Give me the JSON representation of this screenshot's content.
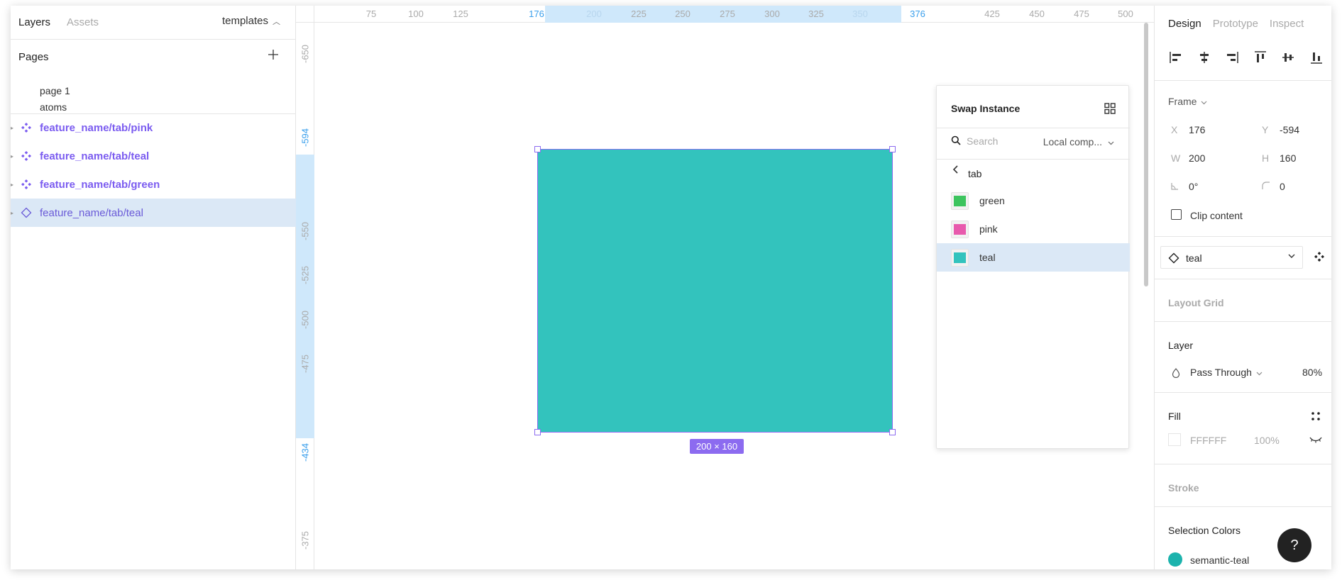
{
  "left_panel": {
    "tabs": [
      {
        "label": "Layers"
      },
      {
        "label": "Assets"
      }
    ],
    "library": "templates",
    "pages_title": "Pages",
    "pages": [
      "page 1",
      "atoms"
    ],
    "layers": [
      {
        "label": "feature_name/tab/pink",
        "kind": "component"
      },
      {
        "label": "feature_name/tab/teal",
        "kind": "component"
      },
      {
        "label": "feature_name/tab/green",
        "kind": "component"
      },
      {
        "label": "feature_name/tab/teal",
        "kind": "instance",
        "selected": true
      }
    ]
  },
  "canvas": {
    "ruler_top": [
      "75",
      "100",
      "125",
      "176",
      "200",
      "225",
      "250",
      "275",
      "300",
      "325",
      "350",
      "376",
      "425",
      "450",
      "475",
      "500"
    ],
    "ruler_left": [
      "-650",
      "-594",
      "-550",
      "-525",
      "-500",
      "-475",
      "-434",
      "-375"
    ],
    "selection_size": "200 × 160",
    "shape_color": "#33c3bd",
    "selection_color": "#8c6bf0"
  },
  "swap_instance": {
    "title": "Swap Instance",
    "search_placeholder": "Search",
    "library": "Local comp...",
    "breadcrumb": "tab",
    "items": [
      {
        "label": "green",
        "color": "#3cc45e"
      },
      {
        "label": "pink",
        "color": "#e85aad"
      },
      {
        "label": "teal",
        "color": "#33c3bd",
        "selected": true
      }
    ]
  },
  "right_panel": {
    "tabs": [
      {
        "label": "Design"
      },
      {
        "label": "Prototype"
      },
      {
        "label": "Inspect"
      }
    ],
    "frame_label": "Frame",
    "x_label": "X",
    "x": "176",
    "y_label": "Y",
    "y": "-594",
    "w_label": "W",
    "w": "200",
    "h_label": "H",
    "h": "160",
    "rotation": "0°",
    "radius": "0",
    "clip_content": "Clip content",
    "instance_name": "teal",
    "layout_grid": "Layout Grid",
    "layer_title": "Layer",
    "blend_mode": "Pass Through",
    "opacity": "80%",
    "fill_title": "Fill",
    "fill_hex": "FFFFFF",
    "fill_opacity": "100%",
    "stroke_title": "Stroke",
    "selection_colors_title": "Selection Colors",
    "selection_color_name": "semantic-teal"
  },
  "help_label": "?"
}
